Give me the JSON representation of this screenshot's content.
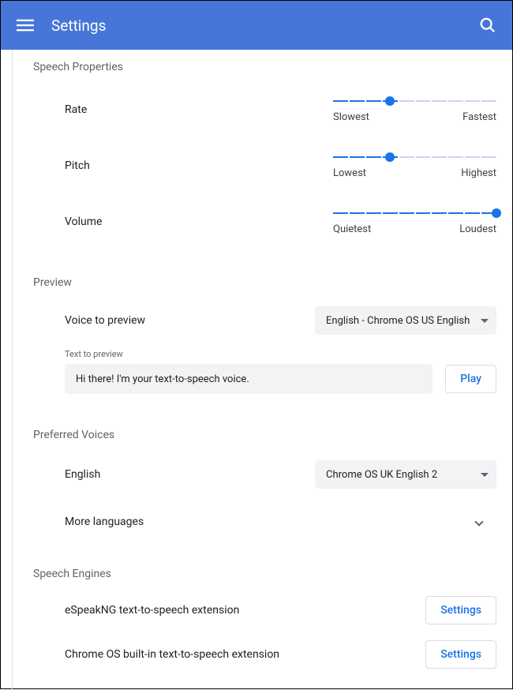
{
  "header": {
    "title": "Settings"
  },
  "speech_properties": {
    "title": "Speech Properties",
    "rate": {
      "label": "Rate",
      "min_label": "Slowest",
      "max_label": "Fastest",
      "value": 35
    },
    "pitch": {
      "label": "Pitch",
      "min_label": "Lowest",
      "max_label": "Highest",
      "value": 35
    },
    "volume": {
      "label": "Volume",
      "min_label": "Quietest",
      "max_label": "Loudest",
      "value": 100
    }
  },
  "preview": {
    "title": "Preview",
    "voice_label": "Voice to preview",
    "voice_selected": "English - Chrome OS US English",
    "text_label": "Text to preview",
    "text_value": "Hi there! I'm your text-to-speech voice.",
    "play_label": "Play"
  },
  "preferred_voices": {
    "title": "Preferred Voices",
    "english_label": "English",
    "english_selected": "Chrome OS UK English 2",
    "more_label": "More languages"
  },
  "speech_engines": {
    "title": "Speech Engines",
    "items": [
      {
        "name": "eSpeakNG text-to-speech extension",
        "button": "Settings"
      },
      {
        "name": "Chrome OS built-in text-to-speech extension",
        "button": "Settings"
      }
    ]
  }
}
